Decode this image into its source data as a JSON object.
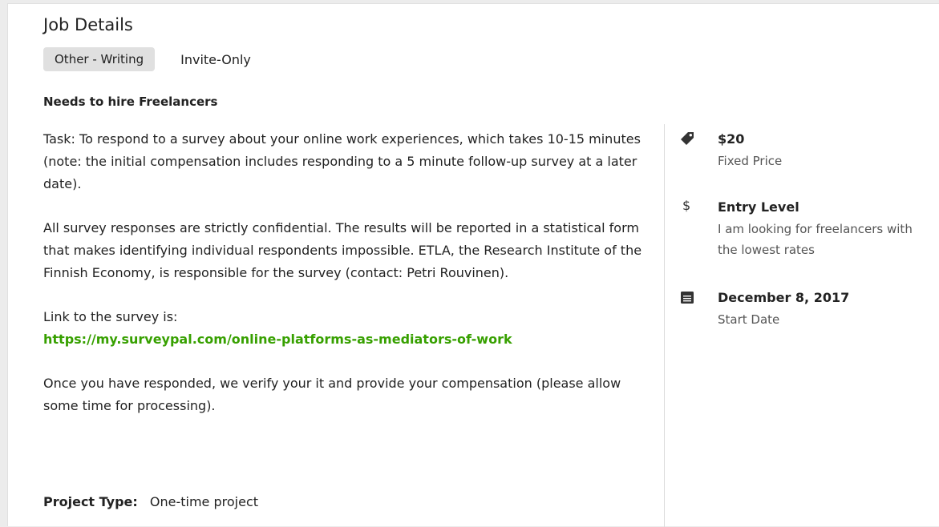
{
  "header": {
    "title": "Job Details",
    "category_tag": "Other - Writing",
    "visibility_tag": "Invite-Only"
  },
  "needs": "Needs to hire Freelancers",
  "description": {
    "paragraph_1": "Task: To respond to a survey about your online work experiences, which takes 10-15 minutes (note: the initial compensation includes responding to a 5 minute follow-up survey at a later date).",
    "paragraph_2": "All survey responses are strictly confidential. The results will be reported in a statistical form that makes identifying individual respondents impossible. ETLA, the Research Institute of the Finnish Economy, is responsible for the survey (contact: Petri Rouvinen).",
    "link_intro": "Link to the survey is:",
    "link_text": "https://my.surveypal.com/online-platforms-as-mediators-of-work",
    "paragraph_3": "Once you have responded, we verify your it and provide your compensation (please allow some time for processing)."
  },
  "project": {
    "label": "Project Type:",
    "value": "One-time project"
  },
  "sidebar": {
    "price": {
      "icon": "price-tag-icon",
      "value": "$20",
      "sub": "Fixed Price"
    },
    "level": {
      "icon": "dollar-sign-icon",
      "symbol": "$",
      "value": "Entry Level",
      "sub": "I am looking for freelancers with the lowest rates"
    },
    "date": {
      "icon": "calendar-icon",
      "value": "December 8, 2017",
      "sub": "Start Date"
    }
  },
  "colors": {
    "link": "#37a000",
    "tag_background": "#e0e0e0",
    "text": "#222222",
    "muted": "#555555"
  }
}
